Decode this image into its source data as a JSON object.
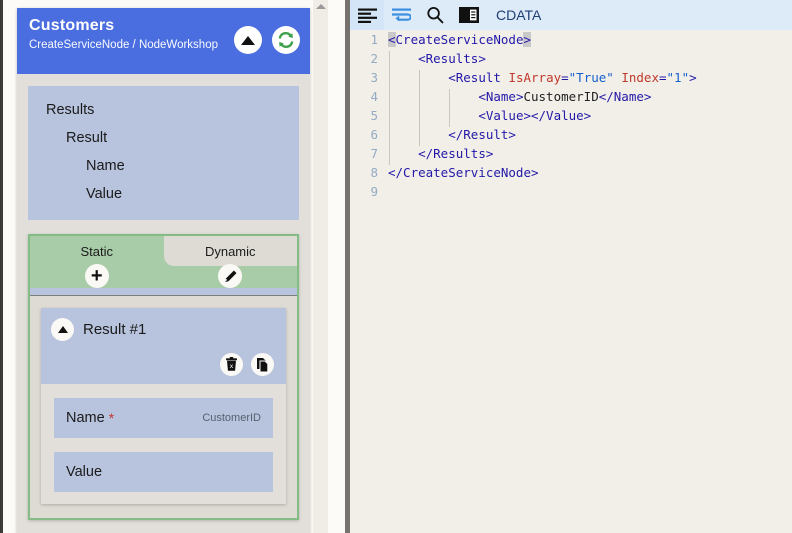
{
  "left_panel": {
    "node": {
      "title": "Customers",
      "subtitle": "CreateServiceNode / NodeWorkshop",
      "collapse_icon": "triangle-up-icon",
      "refresh_icon": "refresh-icon",
      "header_color": "#4a6ee0"
    },
    "schema_tree": [
      {
        "label": "Results",
        "level": 0
      },
      {
        "label": "Result",
        "level": 1
      },
      {
        "label": "Name",
        "level": 2
      },
      {
        "label": "Value",
        "level": 2
      }
    ],
    "tabs": {
      "items": [
        {
          "label": "Static",
          "active": true,
          "action_icon": "plus-icon"
        },
        {
          "label": "Dynamic",
          "active": false,
          "action_icon": "pencil-icon"
        }
      ],
      "accent_color": "#85bb85"
    },
    "result_item": {
      "title": "Result #1",
      "collapse_icon": "triangle-up-icon",
      "delete_icon": "trash-x-icon",
      "copy_icon": "copy-icon",
      "fields": [
        {
          "label": "Name",
          "required": true,
          "value": "CustomerID",
          "placeholder": ""
        },
        {
          "label": "Value",
          "required": false,
          "value": "",
          "placeholder": ""
        }
      ]
    },
    "scrollbar": {
      "up_arrow_icon": "scroll-up-arrow-icon"
    }
  },
  "right_panel": {
    "toolbar": {
      "buttons": [
        {
          "name": "format-lines-icon",
          "label": "",
          "selected": true
        },
        {
          "name": "word-wrap-icon",
          "label": "",
          "selected": false
        },
        {
          "name": "search-icon",
          "label": "",
          "selected": false
        },
        {
          "name": "cdata-icon",
          "label": "",
          "selected": false
        }
      ],
      "cdata_label": "CDATA"
    },
    "code": {
      "language": "xml",
      "lines": [
        {
          "number": "1",
          "indent": 0,
          "tokens": [
            {
              "t": "tag",
              "v": "<",
              "hl": true
            },
            {
              "t": "tag",
              "v": "CreateServiceNode"
            },
            {
              "t": "tag",
              "v": ">",
              "hl": true
            }
          ]
        },
        {
          "number": "2",
          "indent": 1,
          "tokens": [
            {
              "t": "tag",
              "v": "<Results>"
            }
          ]
        },
        {
          "number": "3",
          "indent": 2,
          "tokens": [
            {
              "t": "tag",
              "v": "<Result "
            },
            {
              "t": "attr",
              "v": "IsArray"
            },
            {
              "t": "tag",
              "v": "="
            },
            {
              "t": "aval",
              "v": "\"True\""
            },
            {
              "t": "tag",
              "v": " "
            },
            {
              "t": "attr",
              "v": "Index"
            },
            {
              "t": "tag",
              "v": "="
            },
            {
              "t": "aval",
              "v": "\"1\""
            },
            {
              "t": "tag",
              "v": ">"
            }
          ]
        },
        {
          "number": "4",
          "indent": 3,
          "tokens": [
            {
              "t": "tag",
              "v": "<Name>"
            },
            {
              "t": "txt",
              "v": "CustomerID"
            },
            {
              "t": "tag",
              "v": "</Name>"
            }
          ]
        },
        {
          "number": "5",
          "indent": 3,
          "tokens": [
            {
              "t": "tag",
              "v": "<Value></Value>"
            }
          ]
        },
        {
          "number": "6",
          "indent": 2,
          "tokens": [
            {
              "t": "tag",
              "v": "</Result>"
            }
          ]
        },
        {
          "number": "7",
          "indent": 1,
          "tokens": [
            {
              "t": "tag",
              "v": "</Results>"
            }
          ]
        },
        {
          "number": "8",
          "indent": 0,
          "tokens": [
            {
              "t": "tag",
              "v": "</CreateServiceNode>"
            }
          ]
        },
        {
          "number": "9",
          "indent": 0,
          "tokens": []
        }
      ]
    }
  }
}
